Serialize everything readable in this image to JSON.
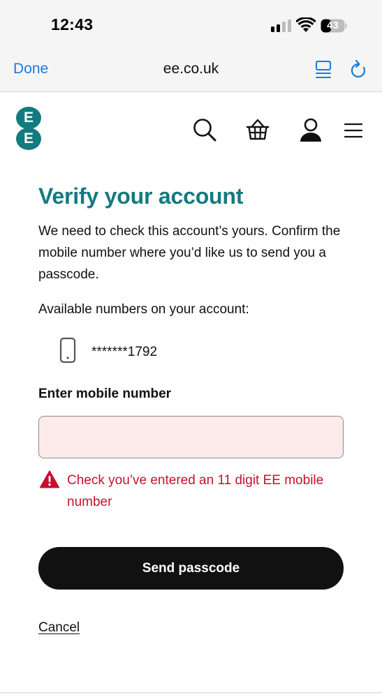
{
  "status_bar": {
    "time": "12:43",
    "battery_level": "43",
    "icons": [
      "signal-icon",
      "wifi-icon",
      "battery-icon"
    ]
  },
  "browser": {
    "done_label": "Done",
    "url": "ee.co.uk",
    "accent_color": "#1a7ae0",
    "icons": [
      "reader-icon",
      "reload-icon"
    ]
  },
  "site_header": {
    "logo_letters": [
      "E",
      "E"
    ],
    "brand_color": "#137a7f",
    "icons": [
      "search-icon",
      "basket-icon",
      "account-icon",
      "menu-icon"
    ]
  },
  "main": {
    "title": "Verify your account",
    "intro": "We need to check this account’s yours. Confirm the mobile number where you’d like us to send you a passcode.",
    "available_label": "Available numbers on your account:",
    "numbers": [
      "*******1792"
    ],
    "field_label": "Enter mobile number",
    "input_value": "",
    "input_background": "#fdeaea",
    "error_message": "Check you’ve entered an 11 digit EE mobile number",
    "error_color": "#c8102e",
    "send_button_label": "Send passcode",
    "cancel_label": "Cancel"
  }
}
